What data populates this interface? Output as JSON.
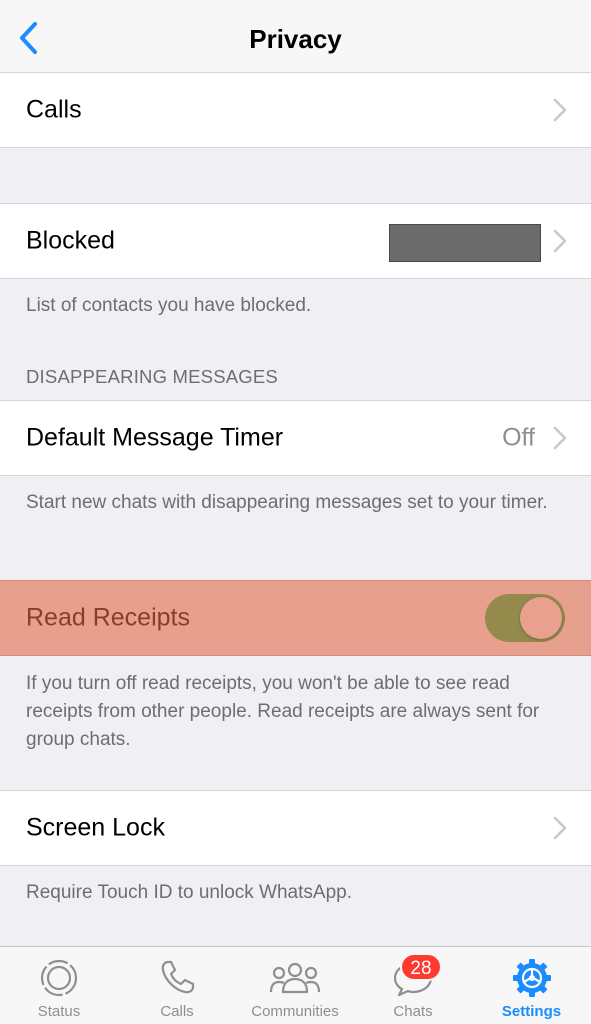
{
  "nav": {
    "title": "Privacy",
    "back_icon": "chevron-left-icon"
  },
  "rows": {
    "calls": {
      "label": "Calls"
    },
    "blocked": {
      "label": "Blocked"
    },
    "timer": {
      "label": "Default Message Timer",
      "value": "Off"
    },
    "read_receipts": {
      "label": "Read Receipts",
      "toggle_on": true
    },
    "screen_lock": {
      "label": "Screen Lock"
    }
  },
  "footers": {
    "blocked": "List of contacts you have blocked.",
    "timer": "Start new chats with disappearing messages set to your timer.",
    "read_receipts": "If you turn off read receipts, you won't be able to see read receipts from other people. Read receipts are always sent for group chats.",
    "screen_lock": "Require Touch ID to unlock WhatsApp."
  },
  "sections": {
    "disappearing": "DISAPPEARING MESSAGES"
  },
  "tabs": [
    {
      "label": "Status",
      "icon": "status-icon"
    },
    {
      "label": "Calls",
      "icon": "phone-icon"
    },
    {
      "label": "Communities",
      "icon": "communities-icon"
    },
    {
      "label": "Chats",
      "icon": "chat-bubble-icon",
      "badge": "28"
    },
    {
      "label": "Settings",
      "icon": "settings-gear-icon",
      "active": true
    }
  ],
  "colors": {
    "accent": "#1a8cff",
    "highlight": "#e8a08e",
    "toggle_track": "#948a4c",
    "badge": "#ff3b30"
  }
}
